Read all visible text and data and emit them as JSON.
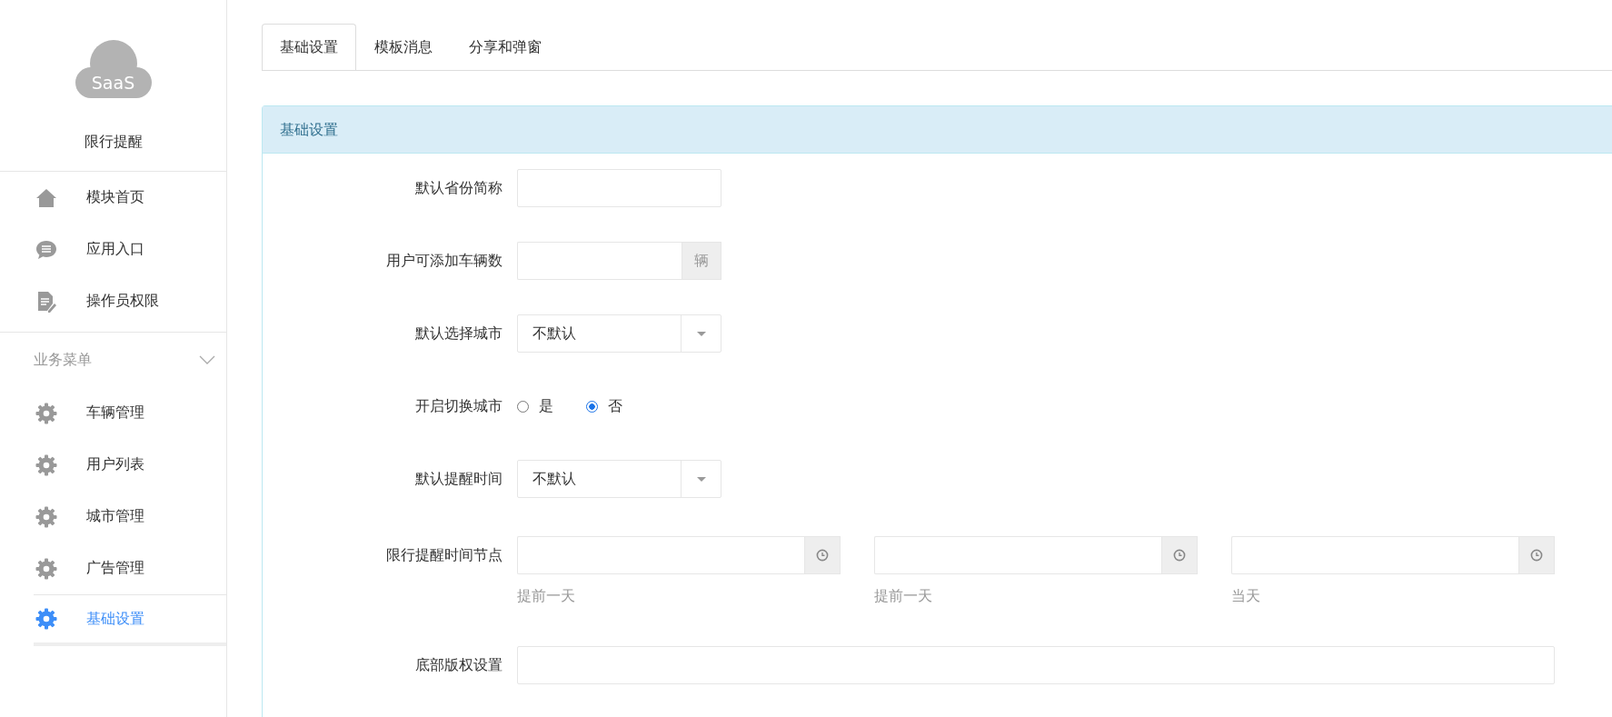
{
  "app": {
    "logo_text": "SaaS",
    "name": "限行提醒"
  },
  "sidebar": {
    "items": [
      {
        "label": "模块首页"
      },
      {
        "label": "应用入口"
      },
      {
        "label": "操作员权限"
      }
    ],
    "section": {
      "title": "业务菜单",
      "expanded": true,
      "items": [
        {
          "label": "车辆管理",
          "selected": false
        },
        {
          "label": "用户列表",
          "selected": false
        },
        {
          "label": "城市管理",
          "selected": false
        },
        {
          "label": "广告管理",
          "selected": false
        },
        {
          "label": "基础设置",
          "selected": true
        }
      ]
    }
  },
  "tabs": [
    {
      "label": "基础设置",
      "selected": true
    },
    {
      "label": "模板消息",
      "selected": false
    },
    {
      "label": "分享和弹窗",
      "selected": false
    }
  ],
  "panel": {
    "title": "基础设置",
    "fields": [
      {
        "kind": "text",
        "label": "默认省份简称"
      },
      {
        "kind": "addon",
        "label": "用户可添加车辆数",
        "addon": "辆"
      },
      {
        "kind": "select",
        "label": "默认选择城市",
        "value": "不默认"
      },
      {
        "kind": "radio",
        "label": "开启切换城市",
        "options": [
          {
            "label": "是",
            "selected": false
          },
          {
            "label": "否",
            "selected": true
          }
        ]
      },
      {
        "kind": "select",
        "label": "默认提醒时间",
        "value": "不默认"
      },
      {
        "kind": "times",
        "label": "限行提醒时间节点",
        "inputs": [
          {
            "help": "提前一天"
          },
          {
            "help": "提前一天"
          },
          {
            "help": "当天"
          }
        ]
      },
      {
        "kind": "wide",
        "label": "底部版权设置"
      }
    ]
  }
}
